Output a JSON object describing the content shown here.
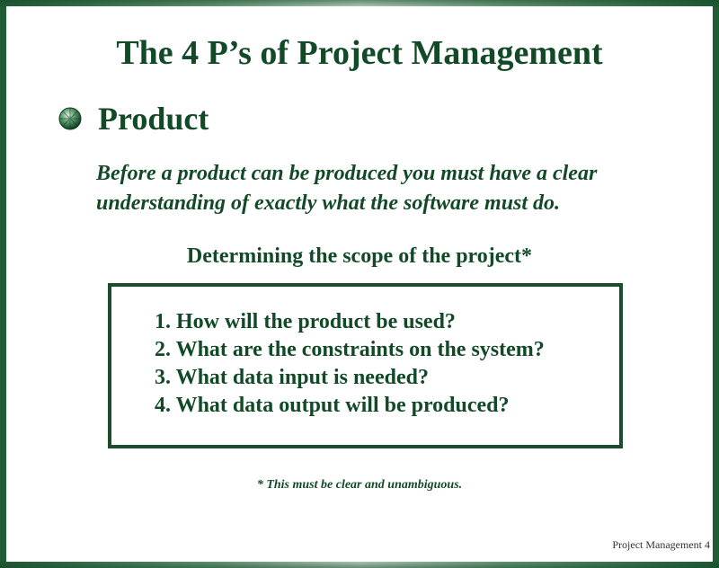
{
  "slide": {
    "title": "The 4 P’s of Project Management",
    "heading": "Product",
    "description": "Before a product can be produced you must have a clear understanding of exactly what the software must do.",
    "subheading": "Determining the scope of the project*",
    "questions": [
      "1. How will the product be used?",
      "2. What are the constraints on the system?",
      "3. What data input is needed?",
      "4. What data output will be produced?"
    ],
    "footnote": "* This must be clear and unambiguous.",
    "slide_number": "Project Management 4"
  },
  "icons": {
    "bullet": "green-sphere-bullet-icon"
  },
  "colors": {
    "text": "#124a28",
    "border": "#1a4d2c",
    "frame": "#1f5c34"
  }
}
